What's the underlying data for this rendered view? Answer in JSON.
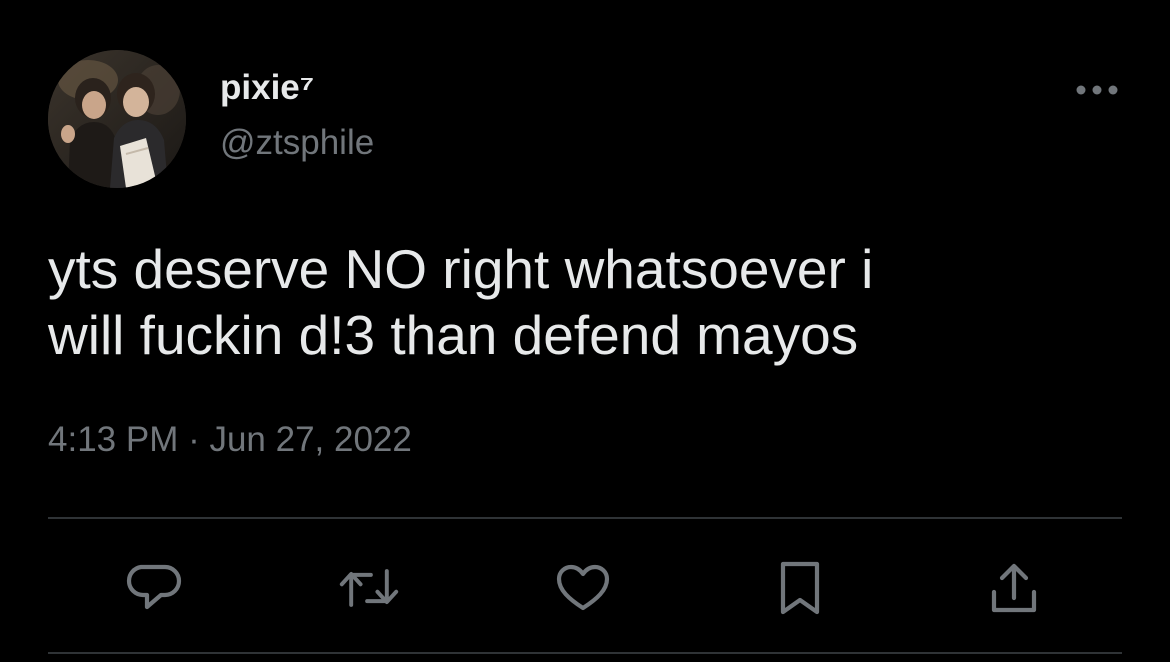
{
  "author": {
    "display_name": "pixie⁷",
    "handle": "@ztsphile"
  },
  "tweet": {
    "text": "yts deserve NO right whatsoever i\nwill fuckin d!3 than defend mayos",
    "time": "4:13 PM",
    "separator": " · ",
    "date": "Jun 27, 2022"
  },
  "actions": [
    {
      "icon": "reply-icon"
    },
    {
      "icon": "retweet-icon"
    },
    {
      "icon": "like-icon"
    },
    {
      "icon": "bookmark-icon"
    },
    {
      "icon": "share-icon"
    }
  ],
  "colors": {
    "background": "#000000",
    "text_primary": "#e7e9ea",
    "text_secondary": "#71767b",
    "icon": "#71767b",
    "divider": "#2f3336"
  }
}
